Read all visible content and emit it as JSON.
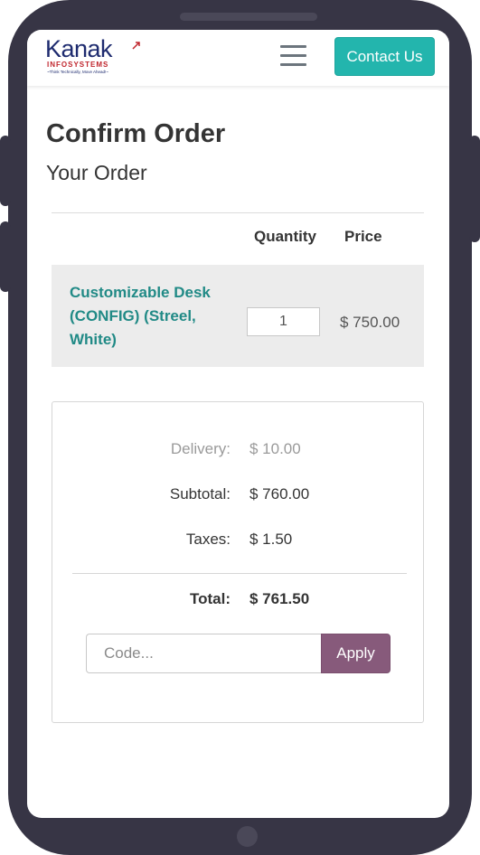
{
  "header": {
    "logo_main": "Kanak",
    "logo_sub": "INFOSYSTEMS",
    "logo_tagline": "~Think Technically, Move Ahead!~",
    "contact_label": "Contact Us"
  },
  "page": {
    "title": "Confirm Order",
    "subtitle": "Your Order"
  },
  "order_table": {
    "headers": {
      "quantity": "Quantity",
      "price": "Price"
    },
    "rows": [
      {
        "product": "Customizable Desk (CONFIG) (Streel, White)",
        "quantity": "1",
        "price": "$ 750.00"
      }
    ]
  },
  "summary": {
    "delivery_label": "Delivery:",
    "delivery_value": "$ 10.00",
    "subtotal_label": "Subtotal:",
    "subtotal_value": "$ 760.00",
    "taxes_label": "Taxes:",
    "taxes_value": "$ 1.50",
    "total_label": "Total:",
    "total_value": "$ 761.50"
  },
  "promo": {
    "placeholder": "Code...",
    "apply_label": "Apply"
  },
  "colors": {
    "frame": "#373545",
    "accent_teal": "#23b5ad",
    "product_link": "#218a86",
    "apply_button": "#875a7b",
    "row_background": "#ececec"
  }
}
